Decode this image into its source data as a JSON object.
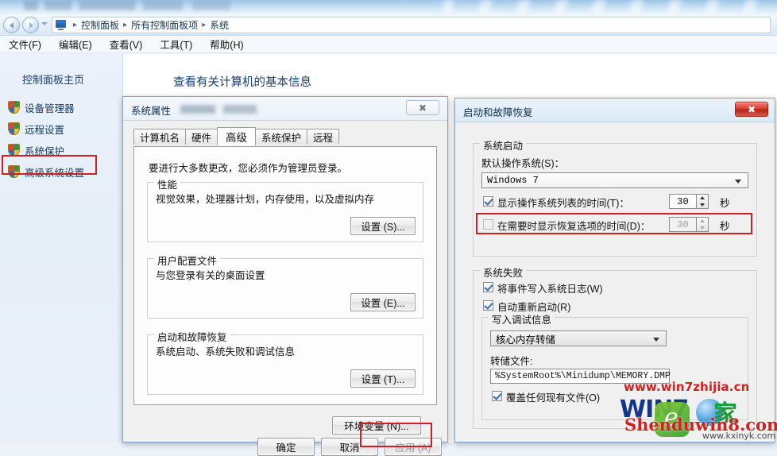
{
  "window": {
    "nav": {
      "back_icon": "back-arrow-icon",
      "forward_icon": "forward-arrow-icon",
      "recent_icon": "chevron-down-icon",
      "breadcrumb_icon": "computer-icon",
      "separator": "▸",
      "crumbs": [
        "控制面板",
        "所有控制面板项",
        "系统"
      ]
    },
    "menu": [
      "文件(F)",
      "编辑(E)",
      "查看(V)",
      "工具(T)",
      "帮助(H)"
    ]
  },
  "sidebar": {
    "heading": "控制面板主页",
    "items": [
      {
        "label": "设备管理器",
        "icon": "shield-icon"
      },
      {
        "label": "远程设置",
        "icon": "shield-icon"
      },
      {
        "label": "系统保护",
        "icon": "shield-icon"
      },
      {
        "label": "高级系统设置",
        "icon": "shield-icon",
        "highlighted": true
      }
    ]
  },
  "content": {
    "heading": "查看有关计算机的基本信息"
  },
  "system_properties": {
    "title": "系统属性",
    "close_icon": "close-icon",
    "tabs": [
      {
        "label": "计算机名",
        "active": false
      },
      {
        "label": "硬件",
        "active": false
      },
      {
        "label": "高级",
        "active": true
      },
      {
        "label": "系统保护",
        "active": false
      },
      {
        "label": "远程",
        "active": false
      }
    ],
    "intro": "要进行大多数更改，您必须作为管理员登录。",
    "groups": [
      {
        "label": "性能",
        "description": "视觉效果，处理器计划，内存使用，以及虚拟内存",
        "button": "设置 (S)..."
      },
      {
        "label": "用户配置文件",
        "description": "与您登录有关的桌面设置",
        "button": "设置 (E)..."
      },
      {
        "label": "启动和故障恢复",
        "description": "系统启动、系统失败和调试信息",
        "button": "设置 (T)...",
        "button_highlighted": true
      }
    ],
    "env_button": "环境变量 (N)...",
    "footer": [
      {
        "label": "确定",
        "enabled": true
      },
      {
        "label": "取消",
        "enabled": true
      },
      {
        "label": "应用 (A)",
        "enabled": false
      }
    ]
  },
  "startup_recovery": {
    "title": "启动和故障恢复",
    "close_icon": "close-icon",
    "system_startup": {
      "label": "系统启动",
      "default_os_label": "默认操作系统(S)：",
      "default_os_value": "Windows 7",
      "timeout_os": {
        "label": "显示操作系统列表的时间(T)：",
        "checked": true,
        "value": "30",
        "unit": "秒"
      },
      "timeout_recovery": {
        "label": "在需要时显示恢复选项的时间(D)：",
        "checked": false,
        "value": "30",
        "unit": "秒",
        "highlighted": true
      }
    },
    "system_failure": {
      "label": "系统失败",
      "write_event": {
        "label": "将事件写入系统日志(W)",
        "checked": true
      },
      "auto_restart": {
        "label": "自动重新启动(R)",
        "checked": true
      },
      "debug_info": {
        "label": "写入调试信息",
        "dump_type": "核心内存转储",
        "dump_file_label": "转储文件:",
        "dump_file_value": "%SystemRoot%\\Minidump\\MEMORY.DMP",
        "overwrite": {
          "label": "覆盖任何现有文件(O)",
          "checked": true
        }
      }
    }
  },
  "watermarks": {
    "url_top": "www.win7zhijia.cn",
    "logo_win7": "WIN7",
    "logo_jia": "家",
    "logo_shen": "Shenduwin8.com",
    "logo_kx": "www.kxinyk.com"
  },
  "colors": {
    "highlight_red": "#cc2026",
    "watermark_red": "#d42020",
    "sidebar_link": "#15395f"
  }
}
